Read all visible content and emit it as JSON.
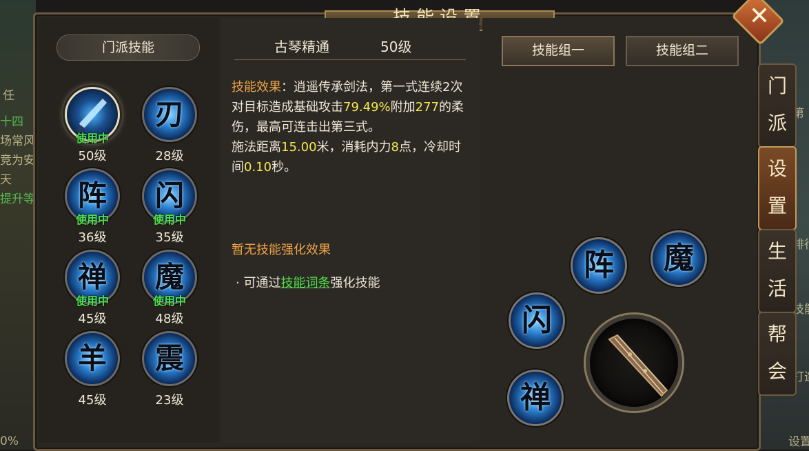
{
  "window": {
    "title": "技能设置"
  },
  "background_text": [
    "任",
    "十四",
    "场常风",
    "竞为安",
    "天",
    "提升等",
    "第",
    "排行",
    "技能",
    "打造",
    "设置",
    "0%"
  ],
  "left": {
    "header": "门派技能",
    "skills": [
      {
        "glyph": "",
        "icon": "sword-skill-icon",
        "in_use": "使用中",
        "level": "50级",
        "selected": true
      },
      {
        "glyph": "刃",
        "in_use": "",
        "level": "28级"
      },
      {
        "glyph": "阵",
        "in_use": "使用中",
        "level": "36级"
      },
      {
        "glyph": "闪",
        "in_use": "使用中",
        "level": "35级"
      },
      {
        "glyph": "禅",
        "in_use": "使用中",
        "level": "45级"
      },
      {
        "glyph": "魔",
        "in_use": "使用中",
        "level": "48级"
      },
      {
        "glyph": "羊",
        "in_use": "",
        "level": "45级"
      },
      {
        "glyph": "震",
        "in_use": "",
        "level": "23级"
      }
    ]
  },
  "detail": {
    "name": "古琴精通",
    "level": "50级",
    "effect_label": "技能效果",
    "effect_part1": "：逍遥传承剑法，第一式连续2次对目标造成基础攻击",
    "attack_pct": "79.49%",
    "effect_part2": "附加",
    "soft_damage": "277",
    "effect_part3": "的柔伤，最高可连击出第三式。",
    "range_label": "施法距离",
    "range": "15.00",
    "range_unit": "米，消耗内力",
    "mana": "8",
    "mana_unit": "点，冷却时间",
    "cooldown": "0.10",
    "cooldown_unit": "秒。",
    "no_enhance": "暂无技能强化效果",
    "hint_prefix": "· 可通过",
    "hint_link": "技能词条",
    "hint_suffix": "强化技能"
  },
  "right": {
    "group1": "技能组一",
    "group2": "技能组二",
    "slots": [
      "阵",
      "魔",
      "闪",
      "禅"
    ]
  },
  "tabs": [
    "门派",
    "设置",
    "生活",
    "帮会"
  ],
  "colors": {
    "accent_orange": "#f0a445",
    "value_yellow": "#f6e64e",
    "in_use_green": "#4ee04a"
  }
}
